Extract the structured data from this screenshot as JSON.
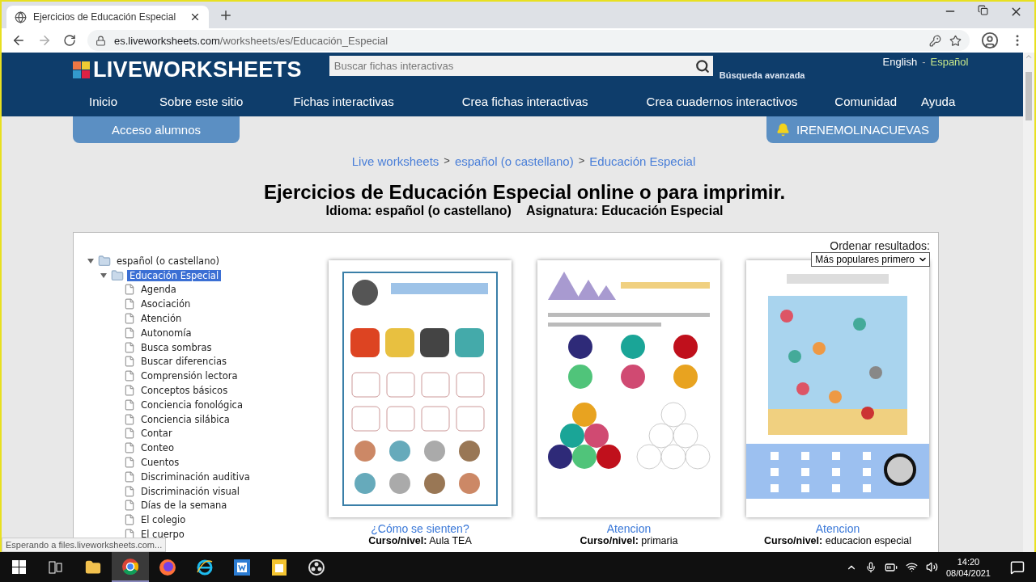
{
  "browser": {
    "tab_title": "Ejercicios de Educación Especial",
    "url_host": "es.liveworksheets.com",
    "url_path": "/worksheets/es/Educación_Especial",
    "status_text": "Esperando a files.liveworksheets.com..."
  },
  "site": {
    "logo": "LIVEWORKSHEETS",
    "search_placeholder": "Buscar fichas interactivas",
    "advanced_search": "Búsqueda avanzada",
    "language_separator": "-",
    "languages": [
      {
        "label": "English",
        "selected": false
      },
      {
        "label": "Español",
        "selected": true
      }
    ],
    "nav": [
      "Inicio",
      "Sobre este sitio",
      "Fichas interactivas",
      "Crea fichas interactivas",
      "Crea cuadernos interactivos",
      "Comunidad",
      "Ayuda"
    ],
    "student_access": "Acceso alumnos",
    "user_name": "IRENEMOLINACUEVAS"
  },
  "breadcrumb_separator": ">",
  "breadcrumbs": [
    "Live worksheets",
    "español (o castellano)",
    "Educación Especial"
  ],
  "heading": "Ejercicios de Educación Especial online o para imprimir.",
  "subheading": [
    "Idioma: español (o castellano)",
    "Asignatura: Educación Especial"
  ],
  "sort": {
    "label": "Ordenar resultados:",
    "value": "Más populares primero"
  },
  "tree": [
    {
      "label": "español (o castellano)",
      "expanded": true,
      "selected": false,
      "children": [
        {
          "label": "Educación Especial",
          "expanded": true,
          "selected": true,
          "children": [
            {
              "label": "Agenda"
            },
            {
              "label": "Asociación"
            },
            {
              "label": "Atención"
            },
            {
              "label": "Autonomía"
            },
            {
              "label": "Busca sombras"
            },
            {
              "label": "Buscar diferencias"
            },
            {
              "label": "Comprensión lectora"
            },
            {
              "label": "Conceptos básicos"
            },
            {
              "label": "Conciencia fonológica"
            },
            {
              "label": "Conciencia silábica"
            },
            {
              "label": "Contar"
            },
            {
              "label": "Conteo"
            },
            {
              "label": "Cuentos"
            },
            {
              "label": "Discriminación auditiva"
            },
            {
              "label": "Discriminación visual"
            },
            {
              "label": "Días de la semana"
            },
            {
              "label": "El colegio"
            },
            {
              "label": "El cuerpo"
            }
          ]
        }
      ]
    }
  ],
  "cards": [
    {
      "kind": "emotions",
      "title": "¿Cómo se sienten?",
      "level": "**Curso/nivel:** Aula TEA"
    },
    {
      "kind": "colors",
      "title": "Atencion",
      "level": "**Curso/nivel:** primaria"
    },
    {
      "kind": "sea",
      "title": "Atencion",
      "level": "**Curso/nivel:** educacion especial"
    }
  ],
  "taskbar": {
    "apps": [
      {
        "kind": "explorer",
        "selected": false
      },
      {
        "kind": "chrome",
        "selected": true
      },
      {
        "kind": "firefox",
        "selected": false
      },
      {
        "kind": "ie",
        "selected": false
      },
      {
        "kind": "word",
        "selected": false
      },
      {
        "kind": "file",
        "selected": false
      },
      {
        "kind": "obs",
        "selected": false
      }
    ],
    "time": "14:20",
    "date": "08/04/2021"
  }
}
